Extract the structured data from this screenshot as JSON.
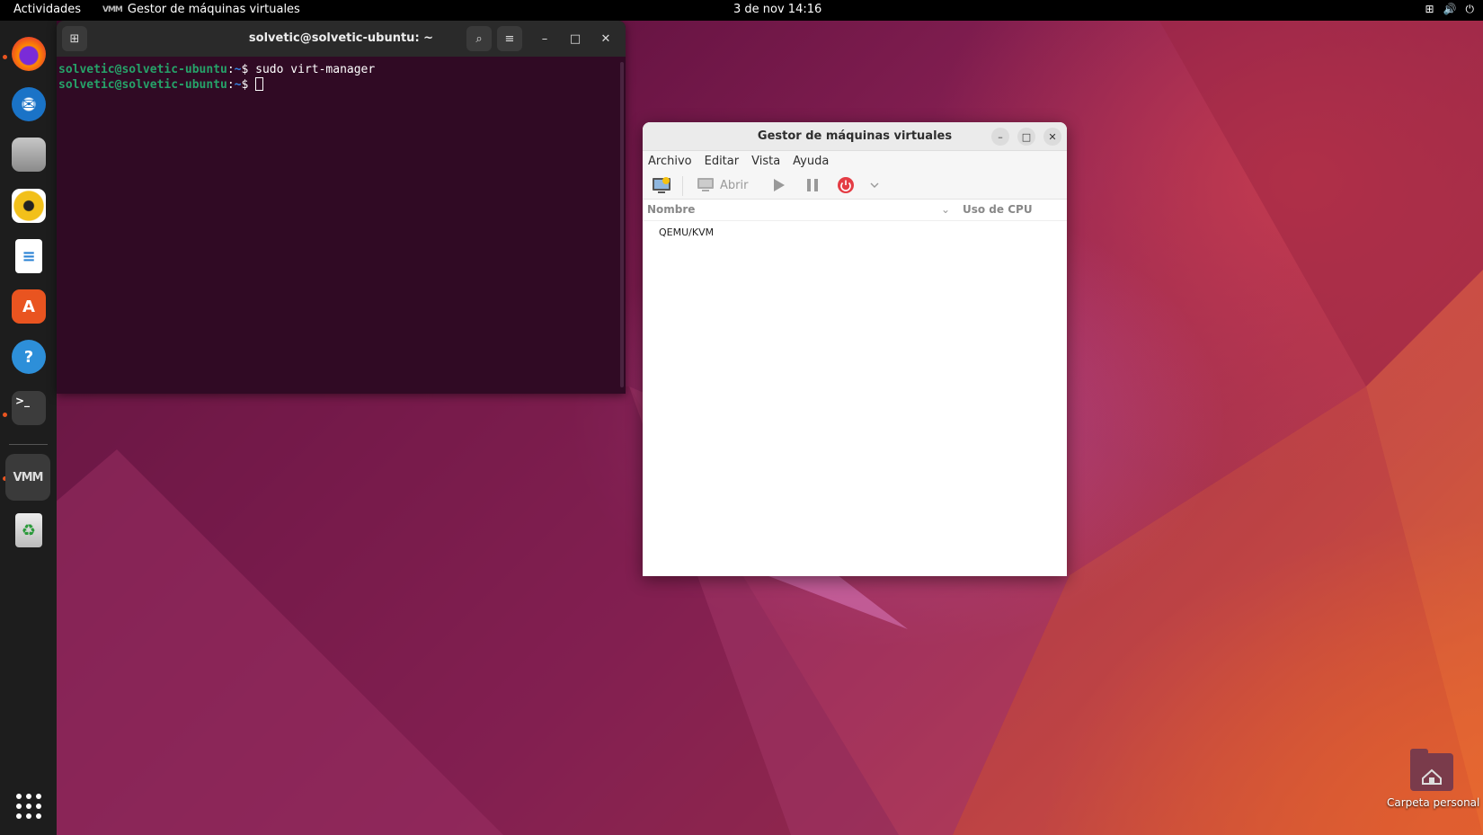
{
  "topbar": {
    "activities": "Actividades",
    "app_name": "Gestor de máquinas virtuales",
    "app_icon_text": "VMM",
    "clock": "3 de nov  14:16",
    "tray": {
      "network_icon": "network-icon",
      "volume_icon": "volume-icon",
      "power_icon": "power-icon"
    }
  },
  "dock": {
    "items": [
      {
        "name": "firefox",
        "glyph": "🦊",
        "color": "#e66000"
      },
      {
        "name": "thunderbird",
        "glyph": "✉",
        "color": "#1a73c7"
      },
      {
        "name": "files",
        "glyph": "▭",
        "color": "#8a8a8a"
      },
      {
        "name": "rhythmbox",
        "glyph": "◉",
        "color": "#f2c01a"
      },
      {
        "name": "writer",
        "glyph": "≡",
        "color": "#2a82d4"
      },
      {
        "name": "software",
        "glyph": "A",
        "color": "#e95420"
      },
      {
        "name": "help",
        "glyph": "?",
        "color": "#2d8fd9"
      },
      {
        "name": "terminal",
        "glyph": ">_",
        "color": "#3c3c3c"
      },
      {
        "name": "virt-manager",
        "glyph": "VMM",
        "color": "#777777"
      },
      {
        "name": "trash",
        "glyph": "♻",
        "color": "#b8b8b8"
      }
    ]
  },
  "terminal": {
    "title": "solvetic@solvetic-ubuntu: ~",
    "lines": [
      {
        "prompt": "solvetic@solvetic-ubuntu",
        "sep": ":",
        "path": "~",
        "symbol": "$",
        "command": " sudo virt-manager"
      },
      {
        "prompt": "solvetic@solvetic-ubuntu",
        "sep": ":",
        "path": "~",
        "symbol": "$",
        "command": " "
      }
    ]
  },
  "vmm": {
    "title": "Gestor de máquinas virtuales",
    "menu": [
      "Archivo",
      "Editar",
      "Vista",
      "Ayuda"
    ],
    "toolbar": {
      "open_label": "Abrir"
    },
    "columns": {
      "name": "Nombre",
      "cpu": "Uso de CPU"
    },
    "connections": [
      "QEMU/KVM"
    ]
  },
  "desktop": {
    "folder_label": "Carpeta personal"
  },
  "colors": {
    "accent": "#e95420",
    "terminal_bg": "#300a24",
    "prompt_green": "#26a269",
    "power_red": "#e01b24"
  }
}
